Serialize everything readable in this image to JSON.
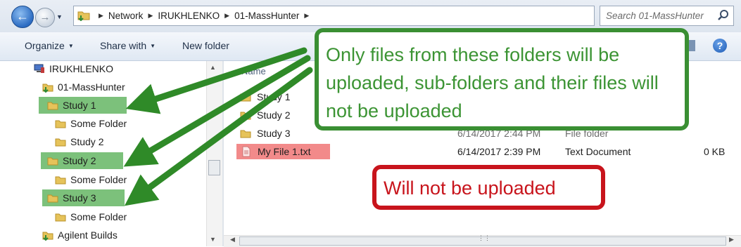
{
  "address_bar": {
    "crumbs": [
      "Network",
      "IRUKHLENKO",
      "01-MassHunter"
    ],
    "search_placeholder": "Search 01-MassHunter"
  },
  "toolbar": {
    "organize": "Organize",
    "share_with": "Share with",
    "new_folder": "New folder"
  },
  "nav_tree": [
    {
      "label": "IRUKHLENKO",
      "icon": "computer-icon",
      "highlighted": false
    },
    {
      "label": "01-MassHunter",
      "icon": "shared-folder-icon",
      "highlighted": false
    },
    {
      "label": "Study 1",
      "icon": "folder-icon",
      "highlighted": true
    },
    {
      "label": "Some Folder",
      "icon": "folder-icon",
      "highlighted": false
    },
    {
      "label": "Study 2",
      "icon": "folder-icon",
      "highlighted": false
    },
    {
      "label": "Study 2",
      "icon": "folder-icon",
      "highlighted": true
    },
    {
      "label": "Some Folder",
      "icon": "folder-icon",
      "highlighted": false
    },
    {
      "label": "Study 3",
      "icon": "folder-icon",
      "highlighted": true
    },
    {
      "label": "Some Folder",
      "icon": "folder-icon",
      "highlighted": false
    },
    {
      "label": "Agilent Builds",
      "icon": "shared-folder-icon",
      "highlighted": false
    }
  ],
  "file_list": {
    "column_name": "Name",
    "rows": [
      {
        "name": "Study 1",
        "date": "",
        "type": "",
        "size": "",
        "highlighted": false
      },
      {
        "name": "Study 2",
        "date": "",
        "type": "",
        "size": "",
        "highlighted": false
      },
      {
        "name": "Study 3",
        "date": "6/14/2017 2:44 PM",
        "type": "File folder",
        "size": "",
        "highlighted": false
      },
      {
        "name": "My File 1.txt",
        "date": "6/14/2017 2:39 PM",
        "type": "Text Document",
        "size": "0 KB",
        "highlighted": true
      }
    ]
  },
  "callouts": {
    "green": "Only files from these folders will be uploaded, sub-folders and their files will not be uploaded",
    "red": "Will not be uploaded"
  },
  "colors": {
    "green_highlight": "#7cc17b",
    "red_highlight": "#f28a8a",
    "green_callout": "#3a8f33",
    "red_callout": "#c8141c",
    "arrow": "#2f8a28"
  }
}
